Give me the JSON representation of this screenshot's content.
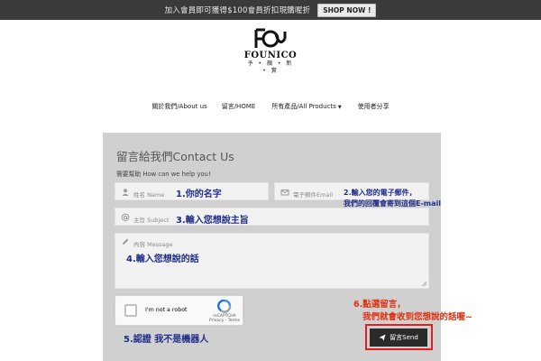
{
  "promo": {
    "text": "加入會員即可獲得$100會員折扣現購喔折",
    "button": "SHOP NOW !"
  },
  "logo": {
    "word": "FOUNICO",
    "tagline": "予 • 顏 • 新 • 實"
  },
  "nav": {
    "items": [
      {
        "label": "關於我們/About us"
      },
      {
        "label": "留言/HOME"
      },
      {
        "label": "所有產品/All Products",
        "has_dropdown": true
      },
      {
        "label": "使用者分享"
      }
    ],
    "caret": "▼"
  },
  "contact": {
    "title": "留言給我們Contact Us",
    "subtitle": "需要幫助 How can we help you!",
    "name_placeholder": "姓名 Name",
    "email_placeholder": "電子郵件Email",
    "subject_placeholder": "主旨 Subject",
    "message_placeholder": "內容 Message",
    "send_label": "留言Send"
  },
  "captcha": {
    "label": "I'm not a robot",
    "brand": "reCAPTCHA",
    "links": "Privacy - Terms"
  },
  "annotations": {
    "a1": "1.你的名字",
    "a2_line1": "2.輸入您的電子郵件，",
    "a2_line2": "我們的回覆會寄到這個E-mail",
    "a3": "3.輸入您想說主旨",
    "a4": "4.輸入您想說的話",
    "a5": "5.認證 我不是機器人",
    "a6_line1": "6.點選留言，",
    "a6_line2": "我們就會收到您想說的話喔~"
  },
  "colors": {
    "promo_bg": "#3a3a3a",
    "panel_bg": "#d0d0d0",
    "annotation_blue": "#1f2e8a",
    "annotation_red": "#e03010",
    "highlight_red": "#e02020"
  }
}
